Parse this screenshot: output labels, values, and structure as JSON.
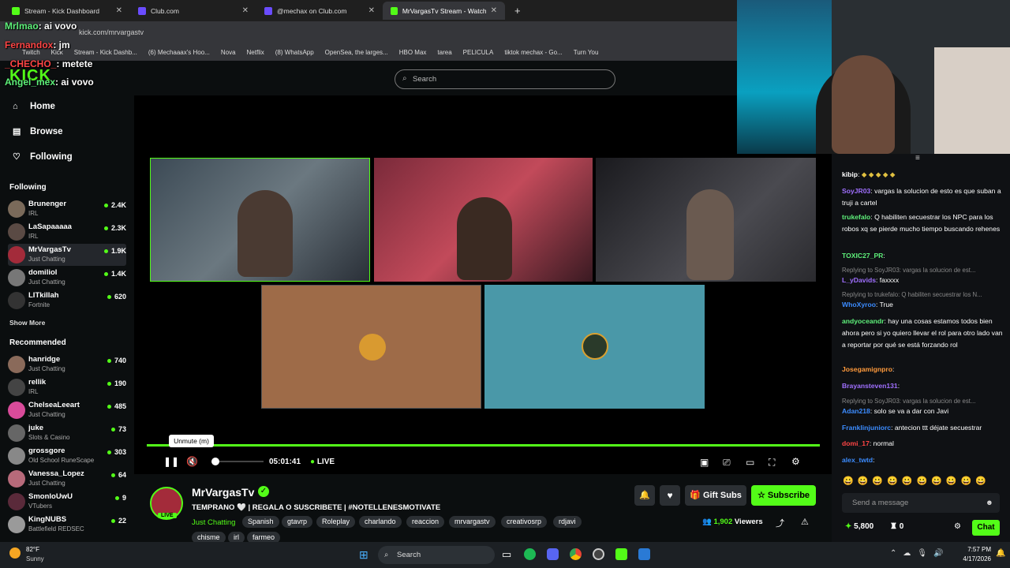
{
  "browser": {
    "tabs": [
      {
        "title": "Stream - Kick Dashboard",
        "color": "#53fc18"
      },
      {
        "title": "Club.com",
        "color": "#6a4cff"
      },
      {
        "title": "@mechax on Club.com",
        "color": "#6a4cff"
      },
      {
        "title": "MrVargasTv Stream - Watch Liv",
        "color": "#53fc18"
      }
    ],
    "new_tab": "+",
    "url": "kick.com/mrvargastv",
    "bookmarks": [
      "Twitch",
      "Kick",
      "Stream - Kick Dashb...",
      "(6) Mechaaax's Hoo...",
      "Nova",
      "Netflix",
      "(8) WhatsApp",
      "OpenSea, the larges...",
      "HBO Max",
      "tarea",
      "PELICULA",
      "tiktok mechax - Go...",
      "Turn You"
    ]
  },
  "overlay_chat": [
    {
      "user": "Mrlmao",
      "text": ": ai vovo",
      "color": "#5ef07a"
    },
    {
      "user": "Fernandox",
      "text": ": jm",
      "color": "#ff4545"
    },
    {
      "user": "_CHECHO_",
      "text": ": metete",
      "color": "#ff4545"
    },
    {
      "user": "Angel_mex",
      "text": ": ai vovo",
      "color": "#5ef07a"
    }
  ],
  "sidebar": {
    "nav": [
      {
        "label": "Home"
      },
      {
        "label": "Browse"
      },
      {
        "label": "Following"
      }
    ],
    "following_title": "Following",
    "following": [
      {
        "name": "Brunenger",
        "cat": "IRL",
        "viewers": "2.4K"
      },
      {
        "name": "LaSapaaaaa",
        "cat": "IRL",
        "viewers": "2.3K"
      },
      {
        "name": "MrVargasTv",
        "cat": "Just Chatting",
        "viewers": "1.9K"
      },
      {
        "name": "domiliol",
        "cat": "Just Chatting",
        "viewers": "1.4K"
      },
      {
        "name": "LITkillah",
        "cat": "Fortnite",
        "viewers": "620"
      }
    ],
    "show_more": "Show More",
    "recommended_title": "Recommended",
    "recommended": [
      {
        "name": "hanridge",
        "cat": "Just Chatting",
        "viewers": "740"
      },
      {
        "name": "rellik",
        "cat": "IRL",
        "viewers": "190"
      },
      {
        "name": "ChelseaLeeart",
        "cat": "Just Chatting",
        "viewers": "485"
      },
      {
        "name": "juke",
        "cat": "Slots & Casino",
        "viewers": "73"
      },
      {
        "name": "grossgore",
        "cat": "Old School RuneScape",
        "viewers": "303"
      },
      {
        "name": "Vanessa_Lopez",
        "cat": "Just Chatting",
        "viewers": "64"
      },
      {
        "name": "SmonloUwU",
        "cat": "VTubers",
        "viewers": "9"
      },
      {
        "name": "KingNUBS",
        "cat": "Battlefield REDSEC",
        "viewers": "22"
      }
    ]
  },
  "search": {
    "placeholder": "Search"
  },
  "player": {
    "tooltip": "Unmute (m)",
    "time": "05:01:41",
    "live": "LIVE",
    "progress": 1.0
  },
  "channel": {
    "name": "MrVargasTv",
    "live_badge": "LIVE",
    "title": "TEMPRANO 🤍 | REGALA O SUSCRIBETE | #NOTELLENESMOTIVATE",
    "category": "Just Chatting",
    "tags": [
      "Spanish",
      "gtavrp",
      "Roleplay",
      "charlando",
      "reaccion",
      "mrvargastv",
      "creativosrp",
      "rdjavi",
      "chisme",
      "irl",
      "farmeo"
    ],
    "viewers": "1,902",
    "viewers_label": "Viewers",
    "gift_subs": "Gift Subs",
    "subscribe": "Subscribe"
  },
  "chat": {
    "messages": [
      {
        "user": "kibip",
        "text": "",
        "color": "#ffffff"
      },
      {
        "user": "SoyJR03",
        "text": ": vargas la solucion de esto es que suban a truji a cartel",
        "color": "#a070ff"
      },
      {
        "user": "trukefalo",
        "text": ": Q habiliten secuestrar los NPC para los robos xq se pierde mucho tiempo buscando rehenes",
        "color": "#5ef07a"
      },
      {
        "user": "TOXIC27_PR",
        "text": ":",
        "color": "#5ef07a"
      },
      {
        "user": "L_yDavids",
        "text": ": faxxxx",
        "color": "#a070ff",
        "reply": "Replying to SoyJR03: vargas la solucion de est..."
      },
      {
        "user": "WhoXyroo",
        "text": ": True",
        "color": "#3c8cff",
        "reply": "Replying to trukefalo: Q habiliten secuestrar los N..."
      },
      {
        "user": "andyoceandr",
        "text": ": hay una cosas estamos todos bien ahora pero si yo quiero llevar el rol para otro lado van a reportar por qué se está forzando rol",
        "color": "#5ef07a"
      },
      {
        "user": "Josegamignpro",
        "text": ":",
        "color": "#ff9a3c"
      },
      {
        "user": "Brayansteven131",
        "text": ":",
        "color": "#a070ff"
      },
      {
        "user": "Adan218",
        "text": ": solo se va a dar con Javi",
        "color": "#3c8cff",
        "reply": "Replying to SoyJR03: vargas la solucion de est..."
      },
      {
        "user": "Franklinjuniorc",
        "text": ": antecion ttt déjate secuestrar",
        "color": "#3c8cff"
      },
      {
        "user": "domi_17",
        "text": ": normal",
        "color": "#ff4545"
      },
      {
        "user": "alex_twtd",
        "text": ":",
        "color": "#3c8cff"
      }
    ],
    "placeholder": "Send a message",
    "points": "5,800",
    "count": "0",
    "chat_button": "Chat"
  },
  "taskbar": {
    "weather_temp": "82°F",
    "weather_desc": "Sunny",
    "search": "Search",
    "time": "7:57 PM",
    "date": "4/17/2026"
  },
  "colors": {
    "kick_green": "#53fc18",
    "background": "#0b0e0f"
  }
}
